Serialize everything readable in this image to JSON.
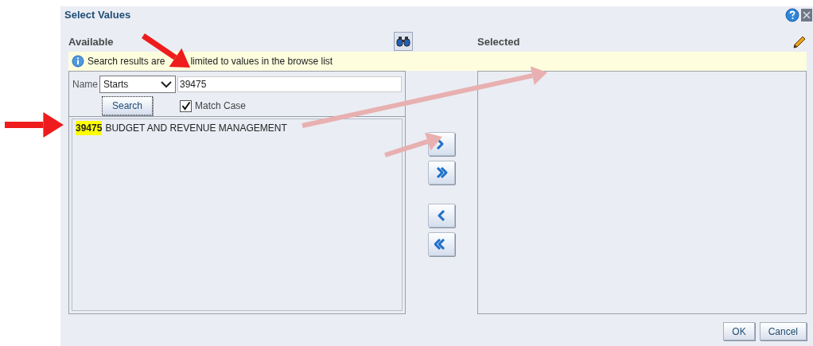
{
  "dialog": {
    "title": "Select Values"
  },
  "available": {
    "heading": "Available"
  },
  "selected_panel": {
    "heading": "Selected"
  },
  "info_bar": {
    "text_before": "Search results are",
    "text_after": "limited to values in the browse list"
  },
  "search": {
    "field_label": "Name",
    "operator": "Starts",
    "value": "39475",
    "button": "Search",
    "match_case": {
      "label": "Match Case",
      "checked": true
    }
  },
  "results": [
    {
      "match": "39475",
      "rest": "BUDGET AND REVENUE MANAGEMENT"
    }
  ],
  "buttons": [
    "OK",
    "Cancel"
  ]
}
